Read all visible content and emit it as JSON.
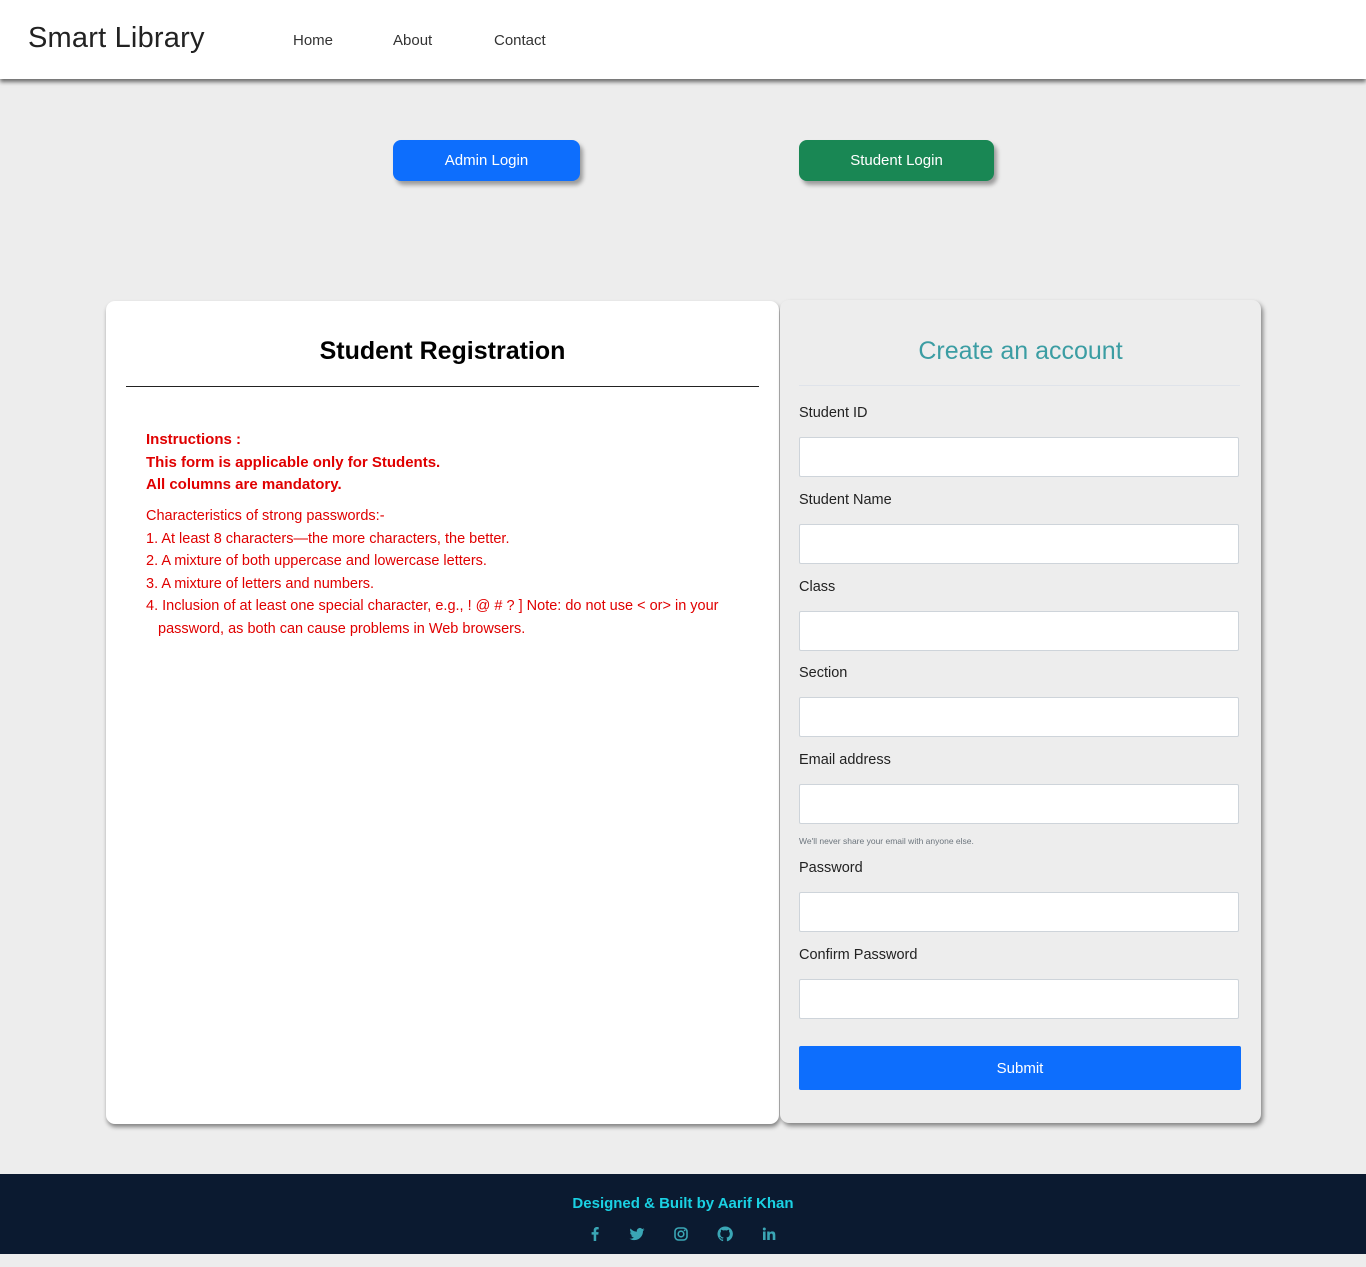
{
  "navbar": {
    "brand": "Smart Library",
    "links": [
      "Home",
      "About",
      "Contact"
    ]
  },
  "top_buttons": {
    "admin_login": "Admin Login",
    "student_login": "Student Login"
  },
  "left_card": {
    "title": "Student Registration",
    "instructions": [
      "Instructions :",
      "This form is applicable only for Students.",
      "All columns are mandatory."
    ],
    "password_rules_heading": "Characteristics of strong passwords:-",
    "password_rules": [
      "1. At least 8 characters—the more characters, the better.",
      "2. A mixture of both uppercase and lowercase letters.",
      "3. A mixture of letters and numbers.",
      "4. Inclusion of at least one special character, e.g., ! @ # ? ] Note: do not use < or> in your password, as both can cause problems in Web browsers."
    ]
  },
  "form": {
    "title": "Create an account",
    "fields": {
      "student_id": {
        "label": "Student ID",
        "value": ""
      },
      "student_name": {
        "label": "Student Name",
        "value": ""
      },
      "class": {
        "label": "Class",
        "value": ""
      },
      "section": {
        "label": "Section",
        "value": ""
      },
      "email": {
        "label": "Email address",
        "value": "",
        "help": "We'll never share your email with anyone else."
      },
      "password": {
        "label": "Password",
        "value": ""
      },
      "confirm_password": {
        "label": "Confirm Password",
        "value": ""
      }
    },
    "submit_label": "Submit"
  },
  "footer": {
    "credit": "Designed & Built by Aarif Khan",
    "social_icons": [
      "facebook-icon",
      "twitter-icon",
      "instagram-icon",
      "github-icon",
      "linkedin-icon"
    ]
  },
  "colors": {
    "primary": "#0d6efd",
    "success": "#198754",
    "danger_text": "#e00000",
    "form_title": "#3b9da3",
    "footer_bg": "#0b1a30",
    "footer_text": "#1ad1e3"
  }
}
